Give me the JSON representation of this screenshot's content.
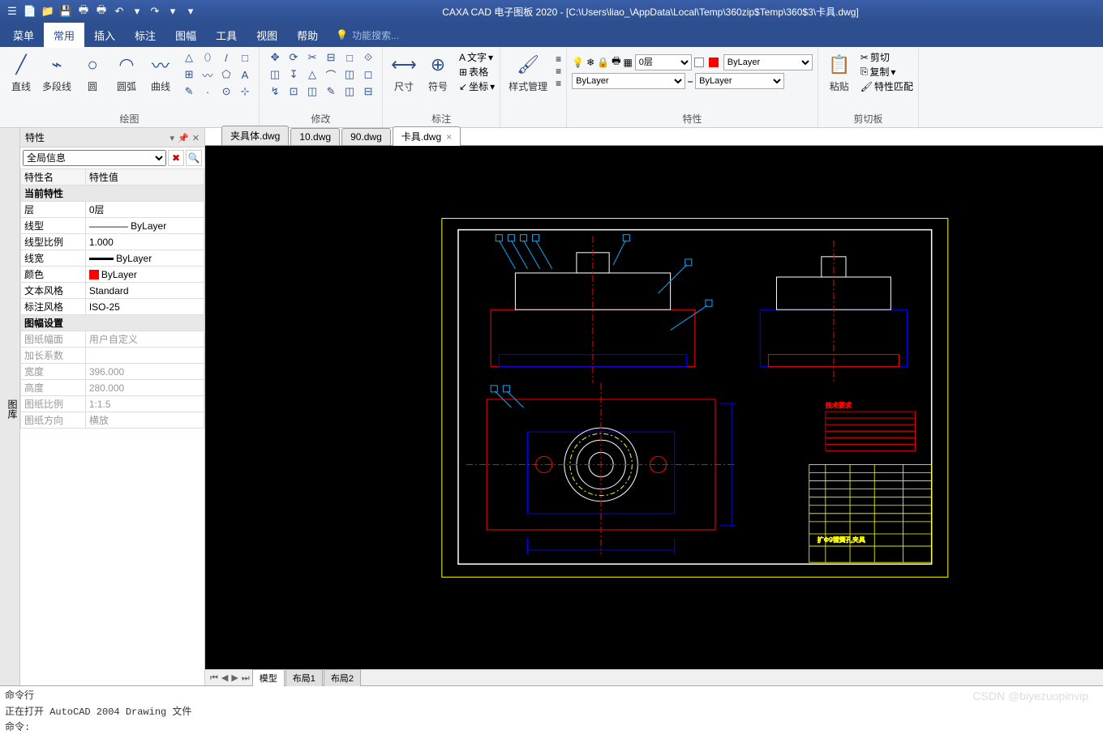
{
  "title": "CAXA CAD 电子图板 2020 - [C:\\Users\\liao_\\AppData\\Local\\Temp\\360zip$Temp\\360$3\\卡具.dwg]",
  "qat": [
    "☰",
    "📄",
    "📁",
    "💾",
    "🖶",
    "🖶",
    "↶",
    "▾",
    "↷",
    "▾",
    "▾"
  ],
  "menu": {
    "file": "菜单",
    "tabs": [
      "常用",
      "插入",
      "标注",
      "图幅",
      "工具",
      "视图",
      "帮助"
    ],
    "active": 0,
    "search_placeholder": "功能搜索..."
  },
  "ribbon": {
    "draw": {
      "label": "绘图",
      "big": [
        {
          "lbl": "直线",
          "ico": "╱"
        },
        {
          "lbl": "多段线",
          "ico": "⌁"
        },
        {
          "lbl": "圆",
          "ico": "○"
        },
        {
          "lbl": "圆弧",
          "ico": "◠"
        },
        {
          "lbl": "曲线",
          "ico": "〰"
        }
      ],
      "small": [
        "△",
        "⬯",
        "/",
        "□",
        "⊞",
        "〰",
        "⬠",
        "A",
        "✎",
        "·",
        "⊙",
        "⊹"
      ]
    },
    "modify": {
      "label": "修改",
      "small": [
        "✥",
        "⟳",
        "✂",
        "⊟",
        "□",
        "⟐",
        "◫",
        "↧",
        "△",
        "⌒",
        "◫",
        "◻",
        "↯",
        "⊡",
        "◫",
        "✎",
        "◫",
        "⊟"
      ]
    },
    "dim": {
      "label": "标注",
      "big": {
        "lbl": "尺寸",
        "ico": "⟷"
      },
      "items": [
        {
          "lbl": "文字",
          "ico": "A"
        },
        {
          "lbl": "表格",
          "ico": "⊞"
        },
        {
          "lbl": "坐标",
          "ico": "↙"
        }
      ],
      "col2": {
        "lbl": "符号",
        "ico": "⊕"
      }
    },
    "style": {
      "label": "样式管理",
      "ico": "🖌"
    },
    "prop": {
      "label": "特性",
      "layer_icons": [
        "💡",
        "❄",
        "🔒",
        "🖶",
        "▦"
      ],
      "layer": "0层",
      "linetype": "ByLayer",
      "lineweight": "ByLayer",
      "color": "ByLayer",
      "match": "≡"
    },
    "clip": {
      "label": "剪切板",
      "paste": "粘贴",
      "items": [
        "剪切",
        "复制",
        "特性匹配"
      ],
      "icons": [
        "✂",
        "⎘",
        "🖌"
      ]
    }
  },
  "sidebar_tab": "图库",
  "panel": {
    "title": "特性",
    "dropdown": "全局信息",
    "cols": [
      "特性名",
      "特性值"
    ],
    "cat1": "当前特性",
    "rows1": [
      {
        "k": "层",
        "v": "0层"
      },
      {
        "k": "线型",
        "v": "ByLayer",
        "line": true
      },
      {
        "k": "线型比例",
        "v": "1.000"
      },
      {
        "k": "线宽",
        "v": "ByLayer",
        "lw": true
      },
      {
        "k": "颜色",
        "v": "ByLayer",
        "color": "#ff0000"
      },
      {
        "k": "文本风格",
        "v": "Standard"
      },
      {
        "k": "标注风格",
        "v": "ISO-25"
      }
    ],
    "cat2": "图幅设置",
    "rows2": [
      {
        "k": "图纸幅面",
        "v": "用户自定义"
      },
      {
        "k": "加长系数",
        "v": ""
      },
      {
        "k": "宽度",
        "v": "396.000"
      },
      {
        "k": "高度",
        "v": "280.000"
      },
      {
        "k": "图纸比例",
        "v": "1:1.5"
      },
      {
        "k": "图纸方向",
        "v": "横放"
      }
    ]
  },
  "doctabs": [
    "夹具体.dwg",
    "10.dwg",
    "90.dwg",
    "卡具.dwg"
  ],
  "doctab_active": 3,
  "layout_tabs": [
    "模型",
    "布局1",
    "布局2"
  ],
  "layout_active": 0,
  "cmd": {
    "label": "命令行",
    "line1": "正在打开 AutoCAD 2004 Drawing 文件",
    "line2": "命令:"
  },
  "drawing": {
    "tblock_text": "扩Φ9镗簧孔夹具",
    "note": "技术要求"
  },
  "watermark": "CSDN @biyezuopinvip"
}
